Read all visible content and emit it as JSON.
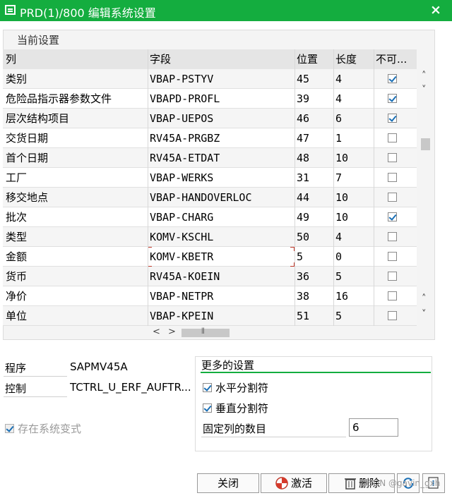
{
  "window": {
    "title": "PRD(1)/800 编辑系统设置",
    "close_glyph": "×"
  },
  "panel": {
    "title": "当前设置"
  },
  "table": {
    "headers": [
      "列",
      "字段",
      "位置",
      "长度",
      "不可..."
    ],
    "rows": [
      {
        "col": "类别",
        "field": "VBAP-PSTYV",
        "pos": "45",
        "len": "4",
        "hidden": true
      },
      {
        "col": "危险品指示器参数文件",
        "field": "VBAPD-PROFL",
        "pos": "39",
        "len": "4",
        "hidden": true
      },
      {
        "col": "层次结构项目",
        "field": "VBAP-UEPOS",
        "pos": "46",
        "len": "6",
        "hidden": true
      },
      {
        "col": "交货日期",
        "field": "RV45A-PRGBZ",
        "pos": "47",
        "len": "1",
        "hidden": false
      },
      {
        "col": "首个日期",
        "field": "RV45A-ETDAT",
        "pos": "48",
        "len": "10",
        "hidden": false
      },
      {
        "col": "工厂",
        "field": "VBAP-WERKS",
        "pos": "31",
        "len": "7",
        "hidden": false
      },
      {
        "col": "移交地点",
        "field": "VBAP-HANDOVERLOC",
        "pos": "44",
        "len": "10",
        "hidden": false
      },
      {
        "col": "批次",
        "field": "VBAP-CHARG",
        "pos": "49",
        "len": "10",
        "hidden": true
      },
      {
        "col": "类型",
        "field": "KOMV-KSCHL",
        "pos": "50",
        "len": "4",
        "hidden": false
      },
      {
        "col": "金额",
        "field": "KOMV-KBETR",
        "pos": "5",
        "len": "0",
        "hidden": false
      },
      {
        "col": "货币",
        "field": "RV45A-KOEIN",
        "pos": "36",
        "len": "5",
        "hidden": false
      },
      {
        "col": "净价",
        "field": "VBAP-NETPR",
        "pos": "38",
        "len": "16",
        "hidden": false
      },
      {
        "col": "单位",
        "field": "VBAP-KPEIN",
        "pos": "51",
        "len": "5",
        "hidden": false
      }
    ]
  },
  "scroll": {
    "up": "˄",
    "down": "˅",
    "left": "<",
    "right": ">",
    "grip": "⦀"
  },
  "info": {
    "program_label": "程序",
    "program_value": "SAPMV45A",
    "control_label": "控制",
    "control_value": "TCTRL_U_ERF_AUFTR...",
    "system_variant_label": "存在系统变式",
    "system_variant_checked": true
  },
  "more_settings": {
    "title": "更多的设置",
    "horizontal_sep_label": "水平分割符",
    "horizontal_sep_checked": true,
    "vertical_sep_label": "垂直分割符",
    "vertical_sep_checked": true,
    "fixed_cols_label": "固定列的数目",
    "fixed_cols_value": "6"
  },
  "buttons": {
    "close": "关闭",
    "activate": "激活",
    "delete": "删除"
  },
  "watermark": "CSDN @gavin_gxh",
  "colors": {
    "title_bar": "#14ad3f",
    "checkmark": "#1a6fb5"
  }
}
